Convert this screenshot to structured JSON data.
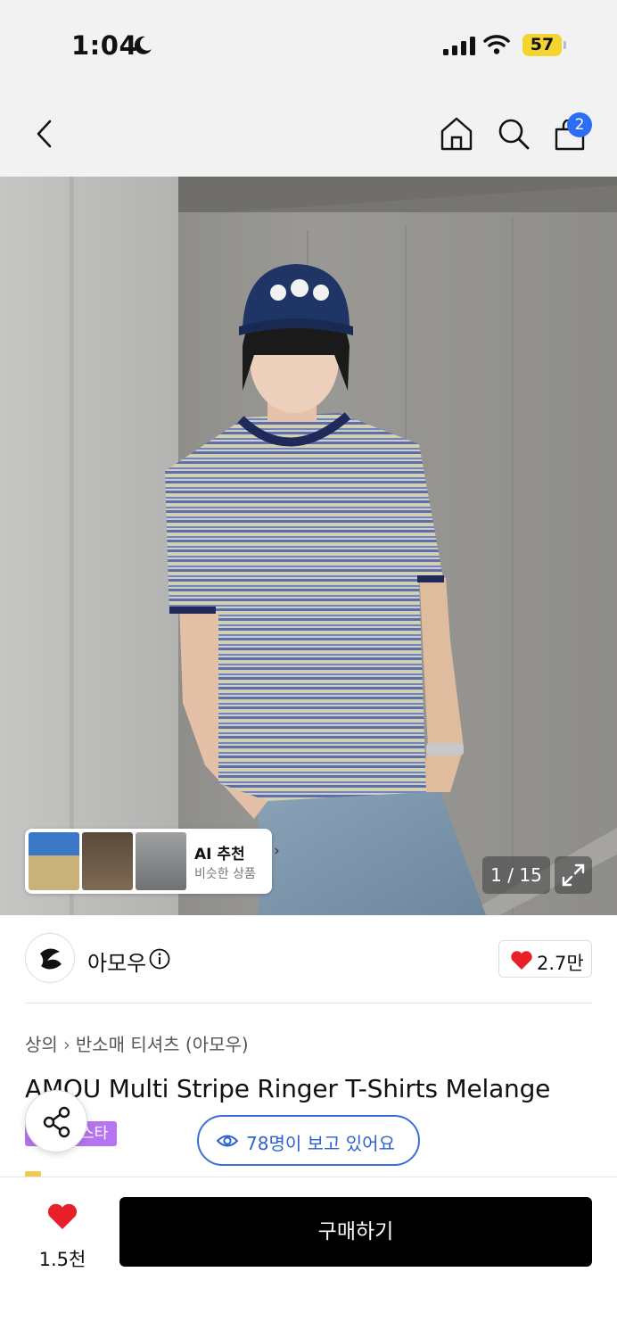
{
  "status_bar": {
    "time": "1:04",
    "battery": "57"
  },
  "nav": {
    "cart_count": "2"
  },
  "gallery": {
    "ai_title": "AI 추천",
    "ai_subtitle": "비슷한 상품",
    "counter": "1 / 15"
  },
  "brand": {
    "name": "아모우",
    "likes": "2.7만"
  },
  "product": {
    "breadcrumb": [
      "상의",
      "반소매 티셔츠 (아모우)"
    ],
    "title": "AMOU Multi Stripe Ringer T-Shirts Melange",
    "tag": "스타",
    "viewers": "78명이 보고 있어요"
  },
  "bottom_bar": {
    "wish_count": "1.5천",
    "buy_label": "구매하기"
  },
  "colors": {
    "accent_blue": "#2d6df6",
    "heart_red": "#e8202a",
    "tag_purple": "#b574f0"
  }
}
